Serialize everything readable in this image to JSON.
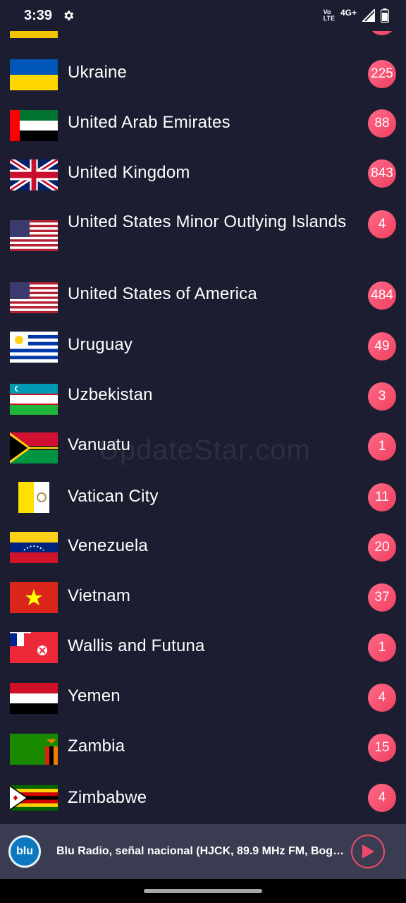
{
  "status": {
    "time": "3:39",
    "volte_top": "Vo",
    "volte_bottom": "LTE",
    "network": "4G+"
  },
  "countries": [
    {
      "name": "Ukraine",
      "count": "225",
      "flag": "ukraine-flag-icon"
    },
    {
      "name": "United Arab Emirates",
      "count": "88",
      "flag": "uae-flag-icon"
    },
    {
      "name": "United Kingdom",
      "count": "843",
      "flag": "uk-flag-icon"
    },
    {
      "name": "United States Minor Outlying Islands",
      "count": "4",
      "flag": "us-minor-islands-flag-icon"
    },
    {
      "name": "United States of America",
      "count": "484",
      "flag": "usa-flag-icon"
    },
    {
      "name": "Uruguay",
      "count": "49",
      "flag": "uruguay-flag-icon"
    },
    {
      "name": "Uzbekistan",
      "count": "3",
      "flag": "uzbekistan-flag-icon"
    },
    {
      "name": "Vanuatu",
      "count": "1",
      "flag": "vanuatu-flag-icon"
    },
    {
      "name": "Vatican City",
      "count": "11",
      "flag": "vatican-flag-icon"
    },
    {
      "name": "Venezuela",
      "count": "20",
      "flag": "venezuela-flag-icon"
    },
    {
      "name": "Vietnam",
      "count": "37",
      "flag": "vietnam-flag-icon"
    },
    {
      "name": "Wallis and Futuna",
      "count": "1",
      "flag": "wallis-futuna-flag-icon"
    },
    {
      "name": "Yemen",
      "count": "4",
      "flag": "yemen-flag-icon"
    },
    {
      "name": "Zambia",
      "count": "15",
      "flag": "zambia-flag-icon"
    },
    {
      "name": "Zimbabwe",
      "count": "4",
      "flag": "zimbabwe-flag-icon"
    }
  ],
  "watermark": "UpdateStar.com",
  "player": {
    "logo_text": "blu",
    "now_playing": "Blu Radio, señal nacional (HJCK, 89.9 MHz FM, Bogotá…"
  },
  "colors": {
    "background": "#1c1d30",
    "badge": "#f0405f",
    "player_bg": "#3a3c52"
  }
}
